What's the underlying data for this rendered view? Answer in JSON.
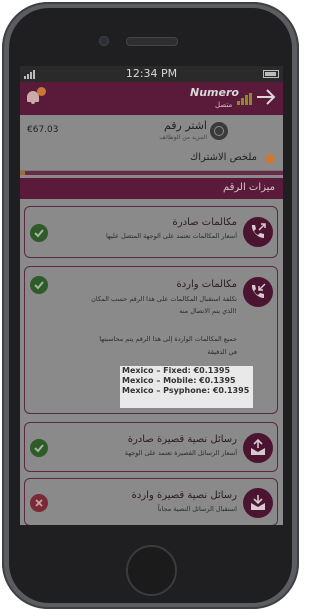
{
  "status": {
    "time": "12:34 PM"
  },
  "header": {
    "logo_text": "Numero",
    "logo_sub": "متصل"
  },
  "account": {
    "balance": "€67.03",
    "title": "اشتر رقم",
    "subtitle": "المزيد من الوظائف"
  },
  "summary": {
    "label": "ملخص الاشتراك"
  },
  "progress": {
    "fraction": 0.02
  },
  "section": {
    "title": "ميزات الرقم"
  },
  "features": [
    {
      "title": "مكالمات صادرة",
      "desc": "أسعار المكالمات تعتمد على الوجهة المتصل عليها",
      "status": "enabled"
    },
    {
      "title": "مكالمات واردة",
      "desc_lines": [
        "تكلفة استقبال المكالمات على هذا الرقم حسب المكان",
        "الذي يتم الاتصال منه!",
        "جميع المكالمات الواردة إلى هذا الرقم يتم محاسبتها",
        "في الدقيقة"
      ],
      "status": "enabled"
    },
    {
      "title": "رسائل نصية قصيرة صادرة",
      "desc": "أسعار الرسائل القصيرة تعتمد على الوجهة",
      "status": "enabled"
    },
    {
      "title": "رسائل نصية قصيرة واردة",
      "desc": "استقبال الرسائل النصية مجاناً",
      "status": "disabled"
    }
  ],
  "tooltip": {
    "rates": [
      "Mexico – Fixed: €0.1395",
      "Mexico – Mobile: €0.1395",
      "Mexico – Psyphone: €0.1395"
    ]
  },
  "colors": {
    "brand": "#5a1a3a",
    "accent": "#c9783a",
    "ok": "#2f5a2a",
    "error": "#7a2a35"
  }
}
